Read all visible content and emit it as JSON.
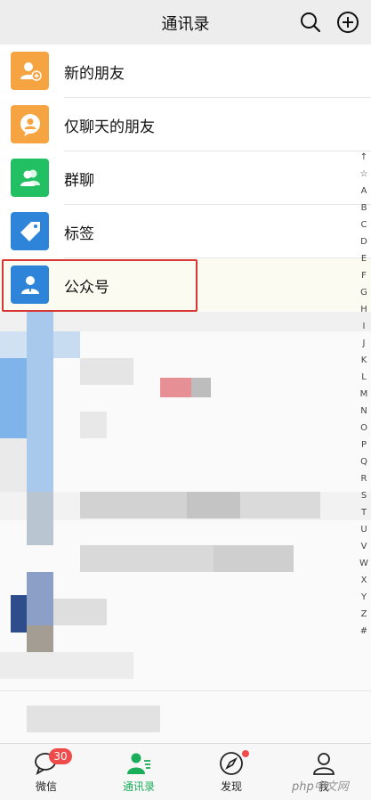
{
  "header": {
    "title": "通讯录",
    "search_icon": "search-icon",
    "add_icon": "plus-circle-icon"
  },
  "list": {
    "items": [
      {
        "label": "新的朋友",
        "icon": "add-friend-icon",
        "color": "#f6a442"
      },
      {
        "label": "仅聊天的朋友",
        "icon": "chat-only-friend-icon",
        "color": "#f6a442"
      },
      {
        "label": "群聊",
        "icon": "group-chat-icon",
        "color": "#22c063"
      },
      {
        "label": "标签",
        "icon": "tag-icon",
        "color": "#2d84d8"
      },
      {
        "label": "公众号",
        "icon": "official-account-icon",
        "color": "#2d84d8"
      }
    ],
    "highlighted_item": "公众号",
    "highlight_color": "#d93636"
  },
  "index_bar": {
    "letters": [
      "↑",
      "☆",
      "A",
      "B",
      "C",
      "D",
      "E",
      "F",
      "G",
      "H",
      "I",
      "J",
      "K",
      "L",
      "M",
      "N",
      "O",
      "P",
      "Q",
      "R",
      "S",
      "T",
      "U",
      "V",
      "W",
      "X",
      "Y",
      "Z",
      "#"
    ]
  },
  "tabbar": {
    "tabs": [
      {
        "label": "微信",
        "icon": "chat-bubble-icon",
        "badge": "30"
      },
      {
        "label": "通讯录",
        "icon": "contacts-icon",
        "active": true
      },
      {
        "label": "发现",
        "icon": "compass-icon",
        "dot": true
      },
      {
        "label": "我",
        "icon": "person-icon"
      }
    ],
    "active_color": "#1aad5a"
  },
  "watermark": {
    "latin": "php",
    "cn": "中文网"
  }
}
